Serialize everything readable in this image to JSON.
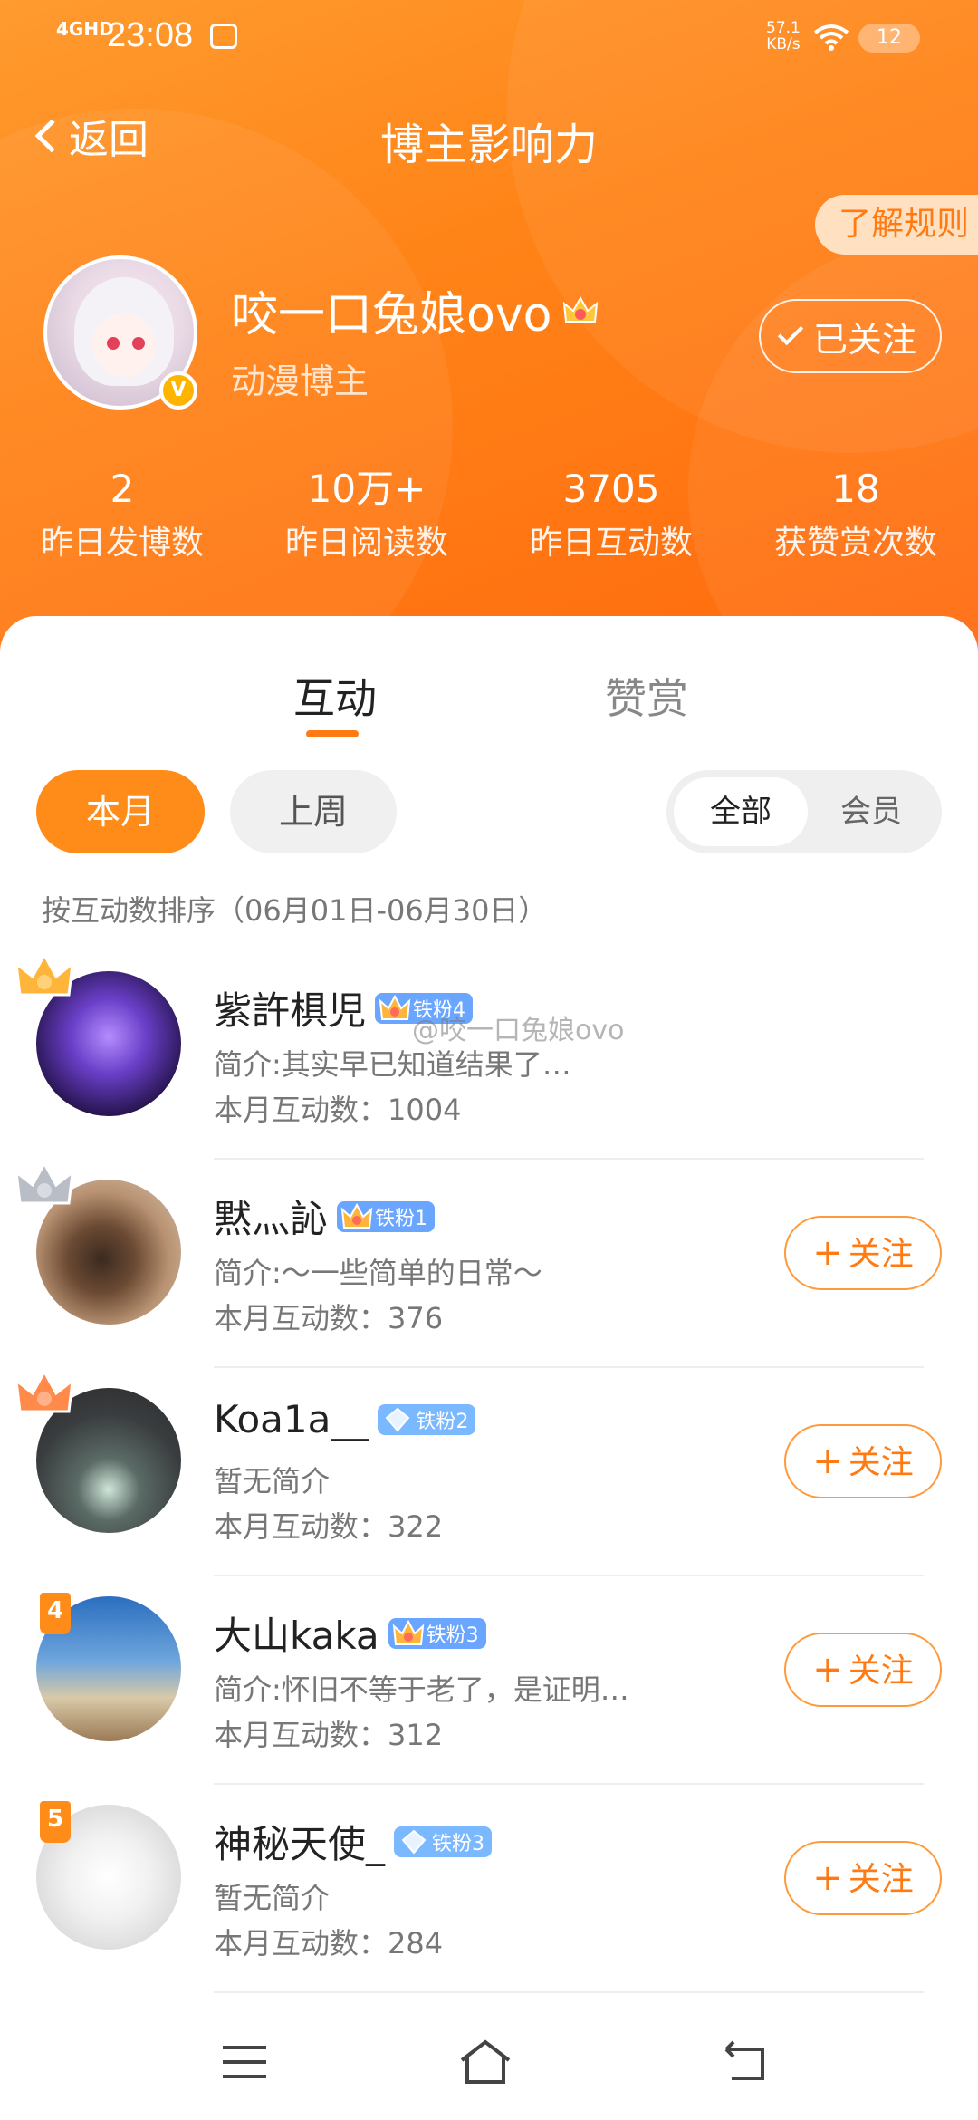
{
  "status_bar": {
    "network": "4GHD",
    "time": "23:08",
    "speed_value": "57.1",
    "speed_unit": "KB/s",
    "battery": "12"
  },
  "nav": {
    "back_label": "返回",
    "title": "博主影响力"
  },
  "rules_button": "了解规则",
  "profile": {
    "name": "咬一口兔娘ovo",
    "description": "动漫博主",
    "follow_state": "已关注",
    "verified_icon": "V"
  },
  "stats": [
    {
      "value": "2",
      "label": "昨日发博数"
    },
    {
      "value": "10万+",
      "label": "昨日阅读数"
    },
    {
      "value": "3705",
      "label": "昨日互动数"
    },
    {
      "value": "18",
      "label": "获赞赏次数"
    }
  ],
  "tabs": {
    "interact": "互动",
    "reward": "赞赏"
  },
  "filters": {
    "this_month": "本月",
    "last_week": "上周",
    "all": "全部",
    "member": "会员"
  },
  "sort_text": "按互动数排序（06月01日-06月30日）",
  "watermark": "@咬一口兔娘ovo",
  "colors": {
    "accent": "#ff8c18",
    "header_gradient_start": "#ff9b2f",
    "header_gradient_end": "#ff6a0e",
    "fan_badge": "#6aa6ff"
  },
  "list": [
    {
      "rank": "1",
      "name": "紫許椇児",
      "badge": "铁粉4",
      "badge_icon": "crown-icon",
      "bio": "简介:其实早已知道结果了…",
      "count_label": "本月互动数：",
      "count": "1004",
      "follow": ""
    },
    {
      "rank": "2",
      "name": "黙灬訫",
      "badge": "铁粉1",
      "badge_icon": "crown-icon",
      "bio": "简介:～一些简单的日常～",
      "count_label": "本月互动数：",
      "count": "376",
      "follow": "关注"
    },
    {
      "rank": "3",
      "name": "Koa1a__",
      "badge": "铁粉2",
      "badge_icon": "diamond-icon",
      "bio": "暂无简介",
      "count_label": "本月互动数：",
      "count": "322",
      "follow": "关注"
    },
    {
      "rank": "4",
      "name": "大山kaka",
      "badge": "铁粉3",
      "badge_icon": "crown-icon",
      "bio": "简介:怀旧不等于老了，是证明…",
      "count_label": "本月互动数：",
      "count": "312",
      "follow": "关注"
    },
    {
      "rank": "5",
      "name": "神秘天使_",
      "badge": "铁粉3",
      "badge_icon": "diamond-icon",
      "bio": "暂无简介",
      "count_label": "本月互动数：",
      "count": "284",
      "follow": "关注"
    }
  ]
}
